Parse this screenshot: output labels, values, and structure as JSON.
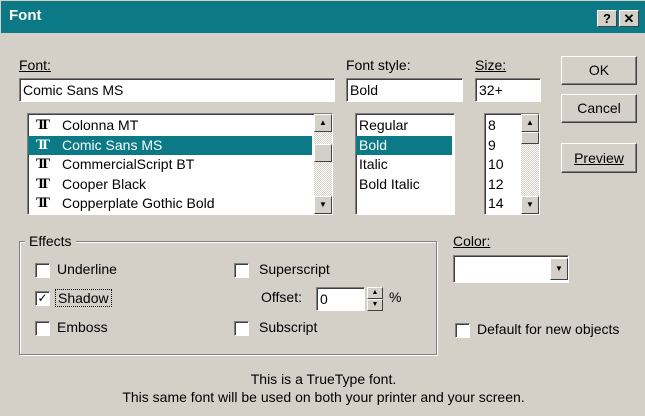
{
  "window": {
    "title": "Font",
    "help_btn": "?",
    "close_btn": "✕"
  },
  "font": {
    "label": "Font:",
    "value": "Comic Sans MS",
    "list": [
      "Colonna MT",
      "Comic Sans MS",
      "CommercialScript BT",
      "Cooper Black",
      "Copperplate Gothic Bold"
    ],
    "selected_index": 1
  },
  "style": {
    "label": "Font style:",
    "value": "Bold",
    "list": [
      "Regular",
      "Bold",
      "Italic",
      "Bold Italic"
    ],
    "selected_index": 1
  },
  "size": {
    "label": "Size:",
    "value": "32+",
    "list": [
      "8",
      "9",
      "10",
      "12",
      "14"
    ]
  },
  "buttons": {
    "ok": "OK",
    "cancel": "Cancel",
    "preview": "Preview"
  },
  "effects": {
    "label": "Effects",
    "underline": {
      "label": "Underline",
      "checked": false
    },
    "superscript": {
      "label": "Superscript",
      "checked": false
    },
    "shadow": {
      "label": "Shadow",
      "checked": true
    },
    "offset": {
      "label": "Offset:",
      "value": "0",
      "unit": "%"
    },
    "emboss": {
      "label": "Emboss",
      "checked": false
    },
    "subscript": {
      "label": "Subscript",
      "checked": false
    }
  },
  "color": {
    "label": "Color:",
    "value": ""
  },
  "default_for_new": {
    "label": "Default for new objects",
    "checked": false
  },
  "info": {
    "line1": "This is a TrueType font.",
    "line2": "This same font will be used on both your printer and your screen."
  },
  "icons": {
    "truetype": "T",
    "check": "✓"
  },
  "colors": {
    "titlebar": "#0c7a86",
    "selection": "#0c7a86",
    "face": "#d4d0c8"
  }
}
